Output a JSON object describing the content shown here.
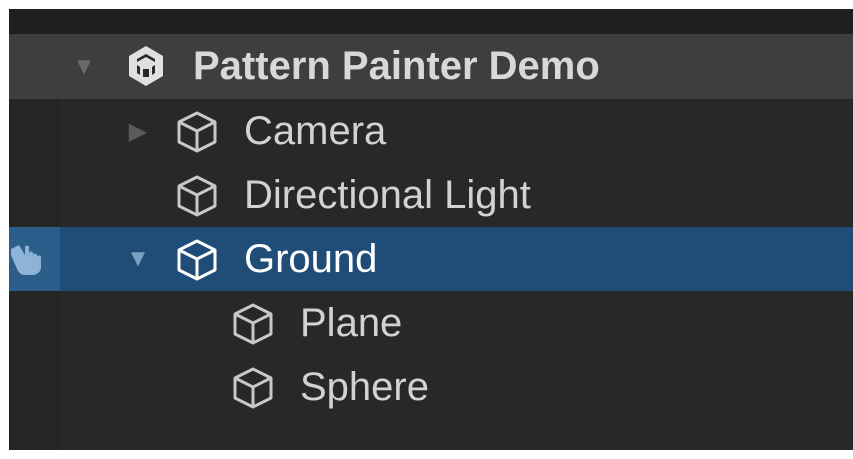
{
  "hierarchy": {
    "scene": {
      "label": "Pattern Painter Demo",
      "icon": "unity-scene-icon",
      "expanded": true
    },
    "items": [
      {
        "label": "Camera",
        "icon": "cube-gameobject-icon",
        "has_children": true,
        "expanded": false,
        "selected": false
      },
      {
        "label": "Directional Light",
        "icon": "cube-gameobject-icon",
        "has_children": false,
        "selected": false
      },
      {
        "label": "Ground",
        "icon": "cube-gameobject-icon",
        "has_children": true,
        "expanded": true,
        "selected": true
      },
      {
        "label": "Plane",
        "icon": "cube-gameobject-icon",
        "has_children": false,
        "selected": false
      },
      {
        "label": "Sphere",
        "icon": "cube-gameobject-icon",
        "has_children": false,
        "selected": false
      }
    ]
  },
  "colors": {
    "background": "#282828",
    "scene_row": "#3e3e3e",
    "selection": "#1f4d77",
    "text": "#d2d2d2"
  }
}
